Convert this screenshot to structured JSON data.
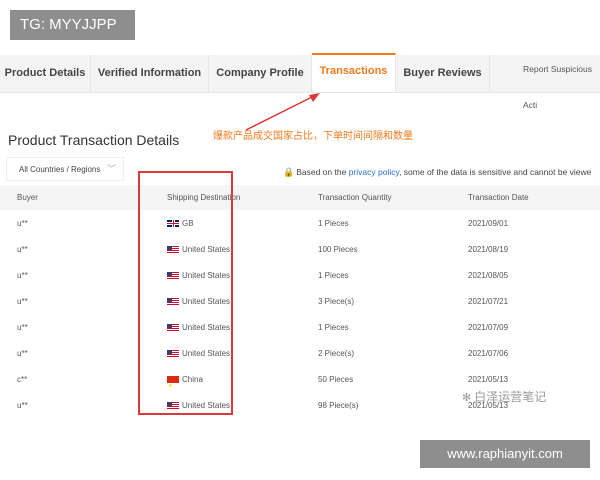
{
  "badges": {
    "tg": "TG: MYYJJPP",
    "site": "www.raphianyit.com"
  },
  "tabs": [
    {
      "label": "Product Details",
      "active": false
    },
    {
      "label": "Verified Information",
      "active": false
    },
    {
      "label": "Company Profile",
      "active": false
    },
    {
      "label": "Transactions",
      "active": true
    },
    {
      "label": "Buyer Reviews",
      "active": false
    }
  ],
  "report_link": "Report Suspicious Acti",
  "page_title": "Product Transaction Details",
  "annotation": "爆款产品成交国家占比，下单时间间隔和数量",
  "filter": {
    "region_selected": "All Countries / Regions"
  },
  "privacy": {
    "before": "Based on the ",
    "link": "privacy policy",
    "after": ", some of the data is sensitive and cannot be viewe"
  },
  "table": {
    "headers": [
      "Buyer",
      "Shipping Destination",
      "Transaction Quantity",
      "Transaction Date"
    ],
    "rows": [
      {
        "buyer": "u**",
        "flag": "gb",
        "destination": "GB",
        "quantity": "1 Pieces",
        "date": "2021/09/01"
      },
      {
        "buyer": "u**",
        "flag": "us",
        "destination": "United States",
        "quantity": "100 Pieces",
        "date": "2021/08/19"
      },
      {
        "buyer": "u**",
        "flag": "us",
        "destination": "United States",
        "quantity": "1 Pieces",
        "date": "2021/08/05"
      },
      {
        "buyer": "u**",
        "flag": "us",
        "destination": "United States",
        "quantity": "3 Piece(s)",
        "date": "2021/07/21"
      },
      {
        "buyer": "u**",
        "flag": "us",
        "destination": "United States",
        "quantity": "1 Pieces",
        "date": "2021/07/09"
      },
      {
        "buyer": "u**",
        "flag": "us",
        "destination": "United States",
        "quantity": "2 Piece(s)",
        "date": "2021/07/06"
      },
      {
        "buyer": "c**",
        "flag": "cn",
        "destination": "China",
        "quantity": "50 Pieces",
        "date": "2021/05/13"
      },
      {
        "buyer": "u**",
        "flag": "us",
        "destination": "United States",
        "quantity": "98 Piece(s)",
        "date": "2021/05/13"
      }
    ]
  },
  "watermark": "白泽运营笔记",
  "colors": {
    "accent": "#f27a1a",
    "annotation_red": "#d93a3a",
    "link": "#2a6fd6"
  }
}
